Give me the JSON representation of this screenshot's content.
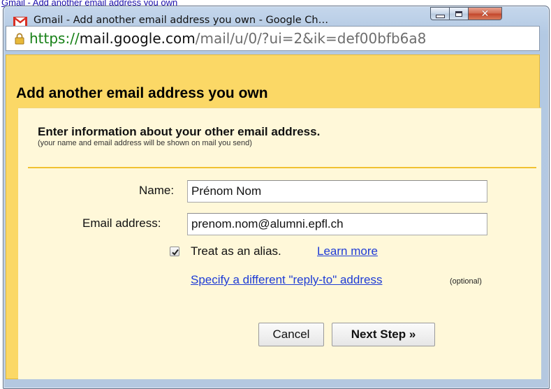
{
  "background": {
    "link_text": "Gmail - Add another email address you own",
    "trailing_text": ""
  },
  "window": {
    "title": "Gmail - Add another email address you own - Google Ch…",
    "url": {
      "scheme": "https://",
      "host": "mail.google.com",
      "path": "/mail/u/0/?ui=2&ik=def00bfb6a8"
    }
  },
  "dialog": {
    "title": "Add another email address you own",
    "section_heading": "Enter information about your other email address.",
    "section_note": "(your name and email address will be shown on mail you send)",
    "fields": {
      "name_label": "Name:",
      "name_value": "Prénom Nom",
      "email_label": "Email address:",
      "email_value": "prenom.nom@alumni.epfl.ch"
    },
    "alias": {
      "checked": true,
      "label": "Treat as an alias.",
      "learn_more": "Learn more"
    },
    "reply_to": {
      "link": "Specify a different \"reply-to\" address",
      "optional": "(optional)"
    },
    "buttons": {
      "cancel": "Cancel",
      "next": "Next Step »"
    }
  },
  "colors": {
    "dialog_header": "#fbd866",
    "panel": "#fff8d9",
    "divider": "#f1c232",
    "link": "#1f3cd6",
    "url_scheme": "#168016"
  },
  "icons": {
    "window": "gmail-icon",
    "address": "lock-icon",
    "minimize": "minimize-icon",
    "maximize": "maximize-icon",
    "close": "close-icon",
    "checkbox": "checkmark-icon"
  }
}
